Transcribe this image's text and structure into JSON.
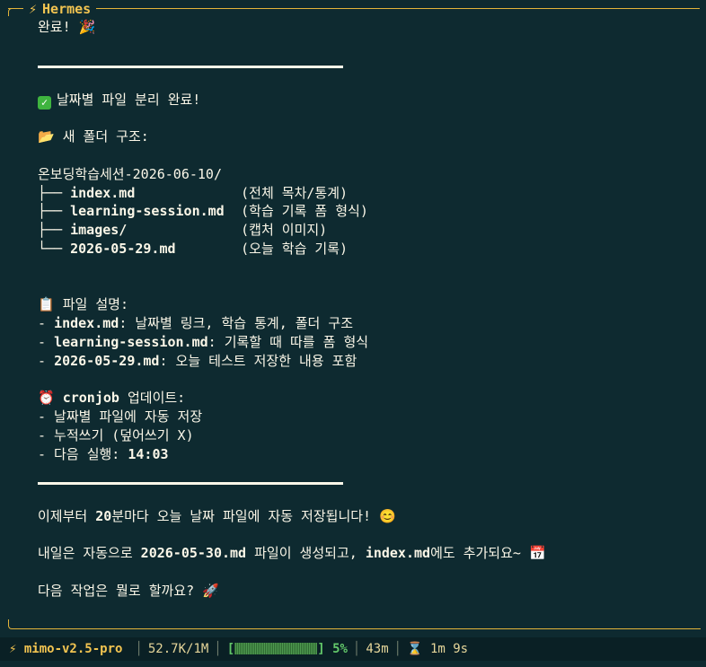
{
  "app": {
    "title": "Hermes",
    "title_icon": "lightning-icon"
  },
  "message": {
    "done": "완료! 🎉",
    "heading": "날짜별 파일 분리 완료!",
    "folder_heading": "📂 새 폴더 구조:",
    "root_folder": "온보딩학습세션-2026-06-10/",
    "tree": [
      {
        "branch": "├── ",
        "name": "index.md",
        "desc": "(전체 목차/통계)"
      },
      {
        "branch": "├── ",
        "name": "learning-session.md",
        "desc": "(학습 기록 폼 형식)"
      },
      {
        "branch": "├── ",
        "name": "images/",
        "desc": "(캡처 이미지)"
      },
      {
        "branch": "└── ",
        "name": "2026-05-29.md",
        "desc": "(오늘 학습 기록)"
      }
    ],
    "files_heading": "📋 파일 설명:",
    "files": [
      {
        "name": "index.md",
        "desc": ": 날짜별 링크, 학습 통계, 폴더 구조"
      },
      {
        "name": "learning-session.md",
        "desc": ": 기록할 때 따를 폼 형식"
      },
      {
        "name": "2026-05-29.md",
        "desc": ": 오늘 테스트 저장한 내용 포함"
      }
    ],
    "cron_heading_icon": "⏰",
    "cron_heading_name": "cronjob",
    "cron_heading_rest": " 업데이트:",
    "cron": [
      "- 날짜별 파일에 자동 저장",
      "- 누적쓰기 (덮어쓰기 X)"
    ],
    "cron_next_label": "- 다음 실행: ",
    "cron_next_time": "14:03",
    "p1_pre": "이제부터 ",
    "p1_bold": "20",
    "p1_post": "분마다 오늘 날짜 파일에 자동 저장됩니다! 😊",
    "p2_pre": "내일은 자동으로 ",
    "p2_bold1": "2026-05-30.md",
    "p2_mid": " 파일이 생성되고, ",
    "p2_bold2": "index.md",
    "p2_post": "에도 추가되요~ 📅",
    "p3": "다음 작업은 뭘로 할까요? 🚀"
  },
  "status": {
    "model": "mimo-v2.5-pro",
    "tokens": "52.7K/1M",
    "bar_open": "[",
    "bar_close": "]",
    "context_percent": "5%",
    "context_fraction": 0.05,
    "elapsed": "43m",
    "timer_icon": "hourglass-icon",
    "duration": "1m 9s",
    "accent": "#f2c451",
    "progress_color": "#63c86a"
  }
}
